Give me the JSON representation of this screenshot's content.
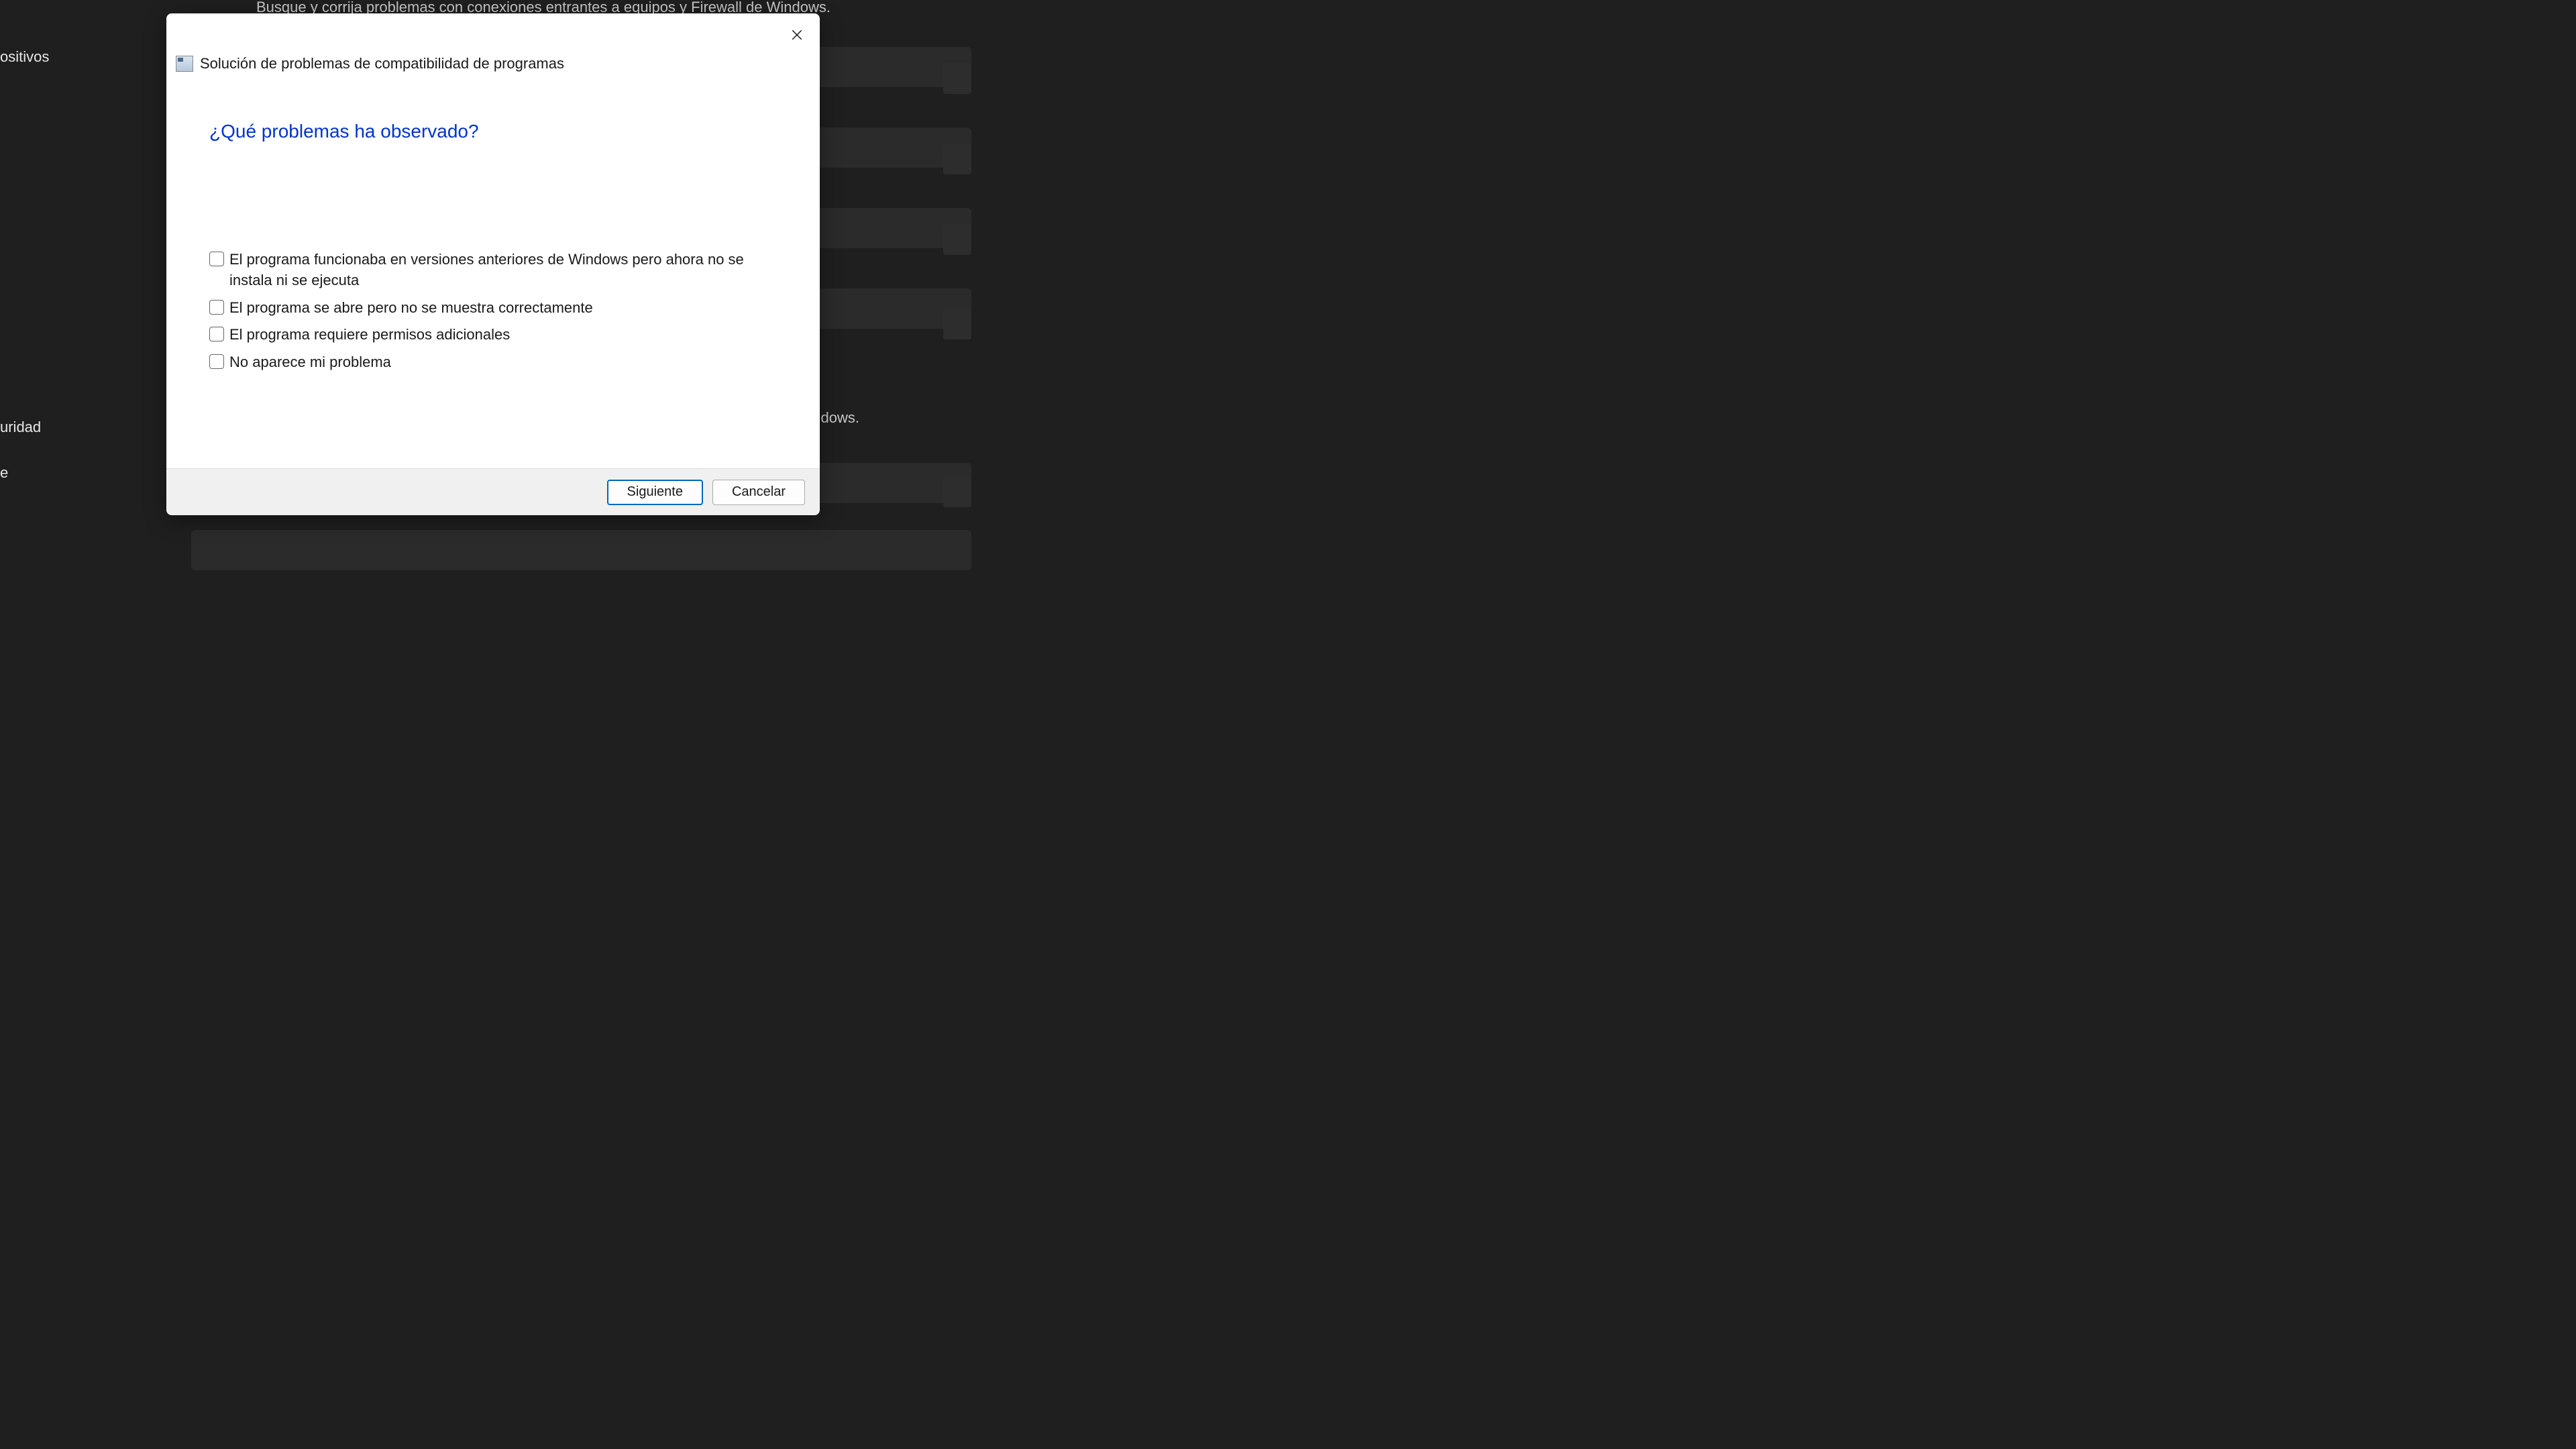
{
  "background": {
    "description_text": "Busque y corrija problemas con conexiones entrantes a equipos y Firewall de Windows.",
    "sidebar_item_1": "ositivos",
    "sidebar_item_2": "uridad",
    "sidebar_item_3": "e",
    "right_text": "dows."
  },
  "dialog": {
    "title": "Solución de problemas de compatibilidad de programas",
    "question": "¿Qué problemas ha observado?",
    "options": [
      "El programa funcionaba en versiones anteriores de Windows pero ahora no se instala ni se ejecuta",
      "El programa se abre pero no se muestra correctamente",
      "El programa requiere permisos adicionales",
      "No aparece mi problema"
    ],
    "buttons": {
      "next": "Siguiente",
      "cancel": "Cancelar"
    }
  }
}
